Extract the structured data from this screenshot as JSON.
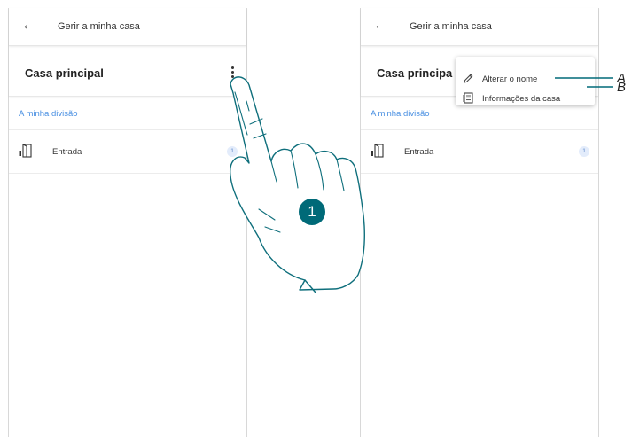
{
  "left_screen": {
    "appbar": {
      "back_icon": "arrow-left-icon",
      "title": "Gerir a minha casa"
    },
    "home_header": {
      "name": "Casa principal",
      "menu_icon": "kebab-menu-icon"
    },
    "section_label": "A minha divisão",
    "room": {
      "icon": "door-icon",
      "name": "Entrada",
      "badge": "1"
    }
  },
  "right_screen": {
    "appbar": {
      "back_icon": "arrow-left-icon",
      "title": "Gerir a minha casa"
    },
    "home_header": {
      "name": "Casa principa"
    },
    "section_label": "A minha divisão",
    "room": {
      "icon": "door-icon",
      "name": "Entrada",
      "badge": "1"
    },
    "menu": {
      "items": [
        {
          "icon": "pencil-icon",
          "label": "Alterar o nome"
        },
        {
          "icon": "document-icon",
          "label": "Informações da casa"
        }
      ]
    }
  },
  "callouts": {
    "a": "A",
    "b": "B",
    "step": "1"
  },
  "colors": {
    "accent_blue": "#4a90e2",
    "callout_teal": "#006a78",
    "badge_bg": "#e3ecfb"
  }
}
